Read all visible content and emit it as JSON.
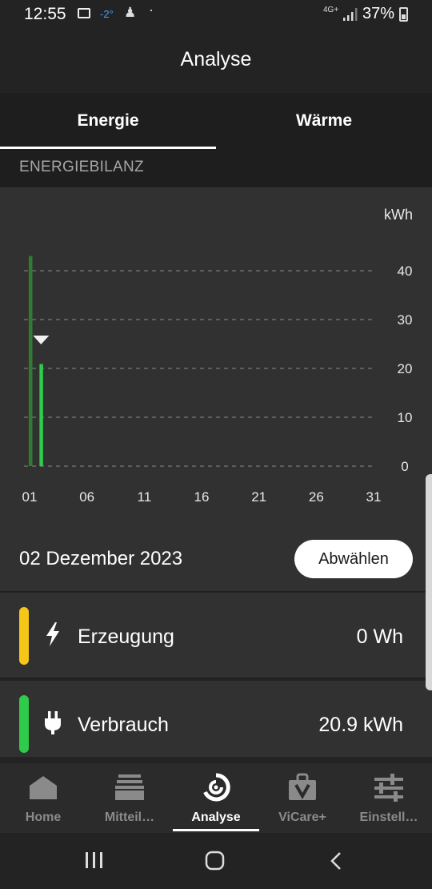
{
  "status_bar": {
    "time": "12:55",
    "temperature": "-2°",
    "network": "4G+",
    "battery": "37%"
  },
  "header": {
    "title": "Analyse"
  },
  "tabs": [
    {
      "label": "Energie",
      "active": true
    },
    {
      "label": "Wärme",
      "active": false
    }
  ],
  "section": {
    "title": "ENERGIEBILANZ"
  },
  "chart_data": {
    "type": "bar",
    "ylabel": "kWh",
    "ylim": [
      0,
      45
    ],
    "yticks": [
      0,
      10,
      20,
      30,
      40
    ],
    "x_tick_labels": [
      "01",
      "06",
      "11",
      "16",
      "21",
      "26",
      "31"
    ],
    "days": 31,
    "series": [
      {
        "color": "#2e7d32",
        "values": [
          {
            "day": 1,
            "value": 43
          }
        ]
      },
      {
        "color": "#2ecc4a",
        "values": [
          {
            "day": 2,
            "value": 20.9
          }
        ]
      }
    ],
    "selected_day": 2,
    "grid": true
  },
  "selection": {
    "date": "02 Dezember 2023",
    "deselect_label": "Abwählen"
  },
  "rows": {
    "generation": {
      "label": "Erzeugung",
      "value": "0 Wh",
      "color": "#f5c518",
      "icon": "lightning-icon"
    },
    "consumption": {
      "label": "Verbrauch",
      "value": "20.9 kWh",
      "color": "#2ecc4a",
      "icon": "plug-icon"
    }
  },
  "bottom_nav": [
    {
      "label": "Home",
      "icon": "home-icon",
      "active": false
    },
    {
      "label": "Mitteil…",
      "icon": "inbox-icon",
      "active": false
    },
    {
      "label": "Analyse",
      "icon": "analysis-icon",
      "active": true
    },
    {
      "label": "ViCare+",
      "icon": "shopping-bag-icon",
      "active": false
    },
    {
      "label": "Einstell…",
      "icon": "sliders-icon",
      "active": false
    }
  ]
}
